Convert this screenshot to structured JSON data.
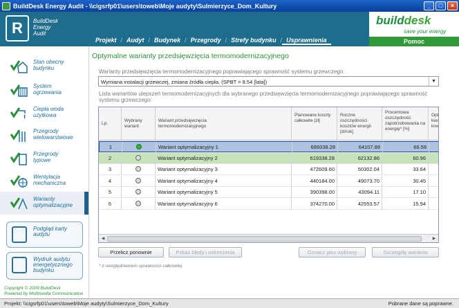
{
  "window": {
    "title": "BuildDesk Energy Audit - \\\\cigsrfp01\\users\\toweb\\Moje audyty\\Sulmierzyce_Dom_Kultury",
    "minimize": "_",
    "maximize": "□",
    "close": "×"
  },
  "header": {
    "logo_line1": "BuildDesk",
    "logo_line2": "Energy",
    "logo_line3": "Audit",
    "brand_part1": "build",
    "brand_part2": "desk",
    "brand_tagline": "save your energy",
    "help": "Pomoc",
    "nav": [
      "Projekt",
      "Audyt",
      "Budynek",
      "Przegrody",
      "Strefy budynku",
      "Usprawnienia"
    ]
  },
  "sidebar": {
    "items": [
      {
        "label_1": "Stan obecny",
        "label_2": "budynku",
        "icon": "house-check-icon"
      },
      {
        "label_1": "System",
        "label_2": "ogrzewania",
        "icon": "radiator-check-icon"
      },
      {
        "label_1": "Ciepła woda",
        "label_2": "użytkowa",
        "icon": "water-tap-check-icon"
      },
      {
        "label_1": "Przegrody",
        "label_2": "wielowarstwowe",
        "icon": "wall-layers-check-icon"
      },
      {
        "label_1": "Przegrody",
        "label_2": "typowe",
        "icon": "wall-check-icon"
      },
      {
        "label_1": "Wentylacja",
        "label_2": "mechaniczna",
        "icon": "fan-check-icon"
      },
      {
        "label_1": "Warianty",
        "label_2": "optymalizacyjne",
        "icon": "variants-check-icon"
      }
    ],
    "btn1_line1": "Podgląd karty",
    "btn1_line2": "audytu",
    "btn2_line1": "Wydruk audytu",
    "btn2_line2": "energetycznego",
    "btn2_line3": "budynku",
    "copyright_1": "Copyright © 2009 BuildDesk",
    "copyright_2": "Powered by Multimedia Communication"
  },
  "main": {
    "title": "Optymalne warianty przedsięwzięcia termomodernizacyjnego",
    "select_label": "Warianty przedsięwzięcia termomodernizacyjnego poprawiającego sprawność systemu grzewczego:",
    "select_value": "Wymiana instalacji grzewczej, zmiana źródła ciepła,     (SPBT = 8.54 [lata])",
    "list_label": "Lista wariantów ulepszeń termomodernizacyjnych dla wybranego przedsięwzięcia termomodernizacyjnego poprawiającego sprawność systemu grzewczego:",
    "columns": [
      "Lp.",
      "Wybrany wariant",
      "Wariant przedsięwzięcia termomodernizacyjnego",
      "Planowane koszty całkowite [zł]",
      "Roczne oszczędności kosztów energii [zł/rok]",
      "Procentowa oszczędność zapotrzebowania na energię* [%]",
      "Opt kwo kred"
    ],
    "rows": [
      {
        "lp": "1",
        "selected": true,
        "name": "Wariant optymalizacyjny 1",
        "cost": "689338.28",
        "savings": "64107.88",
        "pct": "66.58",
        "extra": ""
      },
      {
        "lp": "2",
        "selected": false,
        "name": "Wariant optymalizacyjny 2",
        "cost": "619338.28",
        "savings": "62132.86",
        "pct": "60.96",
        "extra": "4"
      },
      {
        "lp": "3",
        "selected": false,
        "name": "Wariant optymalizacyjny 3",
        "cost": "472609.60",
        "savings": "50302.04",
        "pct": "33.64",
        "extra": ""
      },
      {
        "lp": "4",
        "selected": false,
        "name": "Wariant optymalizacyjny 4",
        "cost": "440184.00",
        "savings": "49073.70",
        "pct": "30.45",
        "extra": ""
      },
      {
        "lp": "5",
        "selected": false,
        "name": "Wariant optymalizacyjny 5",
        "cost": "390398.00",
        "savings": "43094.11",
        "pct": "17.10",
        "extra": ""
      },
      {
        "lp": "6",
        "selected": false,
        "name": "Wariant optymalizacyjny 6",
        "cost": "374270.00",
        "savings": "42553.57",
        "pct": "15.94",
        "extra": ""
      }
    ],
    "buttons": {
      "recalc": "Przelicz ponownie",
      "show_errors": "Pokaż błędy i ostrzeżenia",
      "mark_selected": "Oznacz jako wybrany",
      "details": "Szczegóły wariantu"
    },
    "footnote": "* z uwzględnieniem sprawności całkowitej"
  },
  "status": {
    "left": "Projekt:  \\\\cigsrfp01\\users\\toweb\\Moje audyty\\Sulmierzyce_Dom_Kultury",
    "right": "Pobrane dane są poprawne."
  }
}
